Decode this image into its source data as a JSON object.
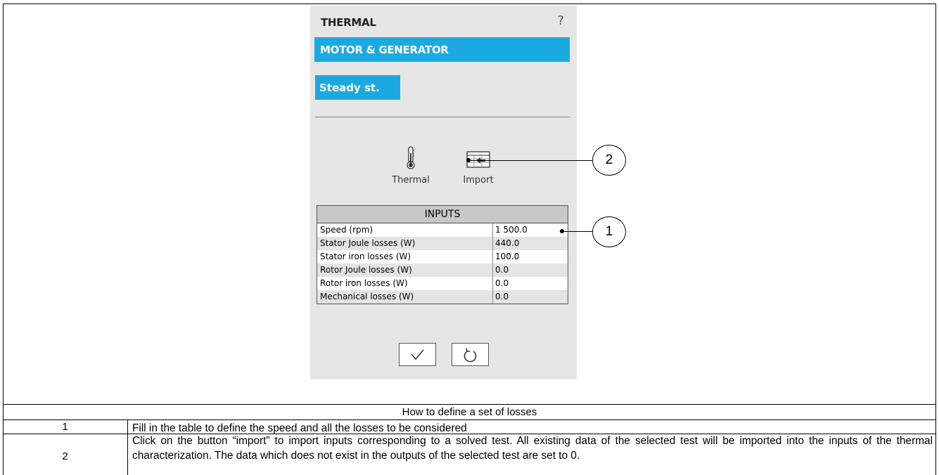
{
  "panel": {
    "title": "THERMAL",
    "help": "?",
    "section": "MOTOR & GENERATOR",
    "mode_button": "Steady st.",
    "tools": [
      {
        "label": "Thermal",
        "icon": "thermometer-icon"
      },
      {
        "label": "Import",
        "icon": "import-icon"
      }
    ],
    "inputs": {
      "header": "INPUTS",
      "rows": [
        {
          "label": "Speed (rpm)",
          "value": "1 500.0"
        },
        {
          "label": "Stator Joule losses (W)",
          "value": "440.0"
        },
        {
          "label": "Stator iron losses (W)",
          "value": "100.0"
        },
        {
          "label": "Rotor Joule losses (W)",
          "value": "0.0"
        },
        {
          "label": "Rotor iron losses (W)",
          "value": "0.0"
        },
        {
          "label": "Mechanical losses (W)",
          "value": "0.0"
        }
      ]
    },
    "actions": [
      {
        "icon": "check-icon"
      },
      {
        "icon": "reset-icon"
      }
    ]
  },
  "callouts": [
    "1",
    "2"
  ],
  "doc": {
    "caption": "How to define a set of losses",
    "rows": [
      {
        "num": "1",
        "text": "Fill in the table to define the speed and all the losses to be considered"
      },
      {
        "num": "2",
        "text": "Click on the button “import” to import inputs corresponding to a solved test. All existing data of the selected test will be imported into the inputs of the thermal characterization. The data which does not exist in the outputs of the selected test are set to 0."
      }
    ]
  }
}
